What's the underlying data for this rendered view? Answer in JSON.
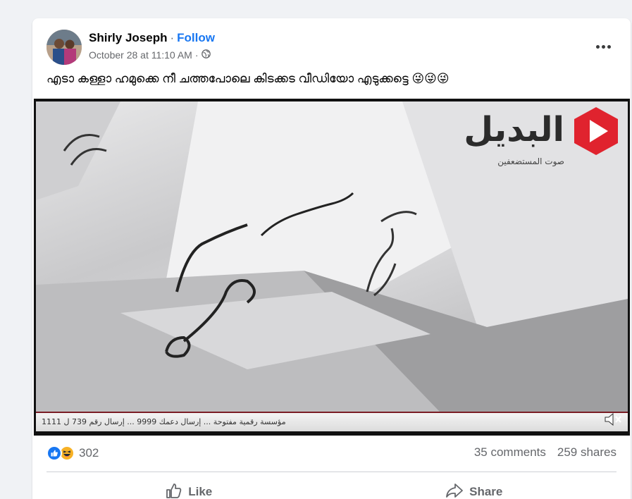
{
  "post": {
    "author": "Shirly Joseph",
    "separator": "·",
    "follow_label": "Follow",
    "timestamp": "October 28 at 11:10 AM",
    "meta_separator": "·",
    "audience_icon": "globe-icon",
    "caption": "എടാ കള്ളാ ഹമുക്കെ നീ ചത്തപോലെ കിടക്കട വീഡിയോ എടുക്കട്ടെ 😜😜😜"
  },
  "video": {
    "logo_text": "البديل",
    "logo_subtitle": "صوت المستضعفين",
    "ticker_text": "مؤسسة رقمية مفتوحة ... إرسال دعمك 9999 ... إرسال رقم 739 ل 1111",
    "mute_icon": "muted-speaker-icon",
    "brand_color": "#e0232e"
  },
  "stats": {
    "reaction_icons": [
      "like-icon",
      "haha-icon"
    ],
    "reaction_count": "302",
    "comments": "35 comments",
    "shares": "259 shares"
  },
  "actions": {
    "like_label": "Like",
    "share_label": "Share"
  },
  "colors": {
    "accent": "#1877f2",
    "secondary_text": "#65676b",
    "background": "#f0f2f5"
  }
}
